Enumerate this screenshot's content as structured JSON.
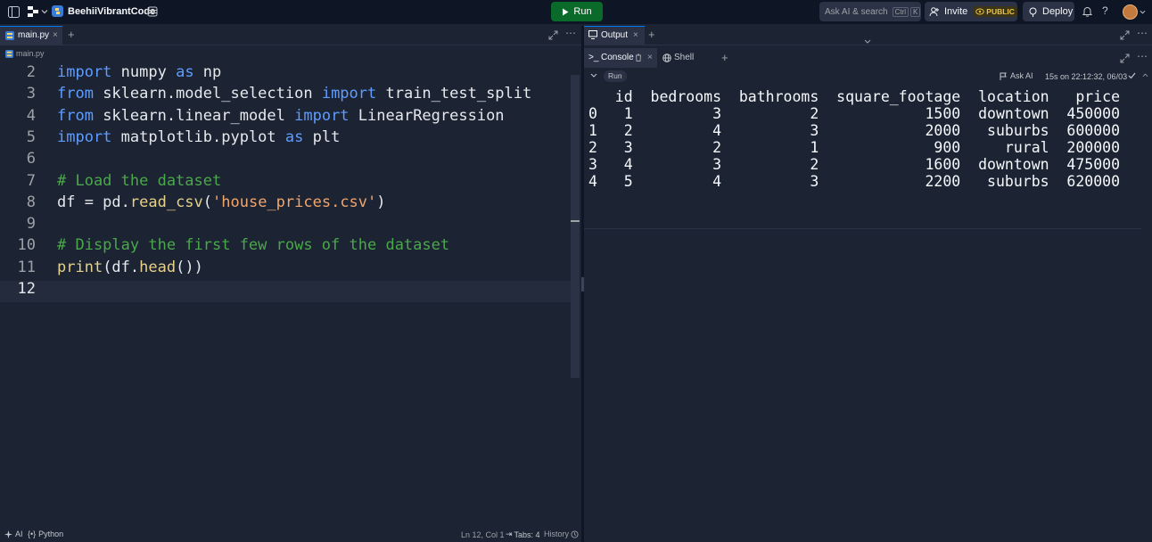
{
  "topbar": {
    "repl_name": "BeehiiVibrantCode",
    "run_label": "Run",
    "search_label": "Ask AI & search",
    "kbd_ctrl": "Ctrl",
    "kbd_k": "K",
    "invite_label": "Invite",
    "public_label": "PUBLIC",
    "deploy_label": "Deploy"
  },
  "editor": {
    "tab_label": "main.py",
    "breadcrumb": "main.py",
    "lines": [
      {
        "n": "2",
        "tokens": [
          [
            "kw",
            "import"
          ],
          [
            "pl",
            " numpy "
          ],
          [
            "kw",
            "as"
          ],
          [
            "pl",
            " np"
          ]
        ]
      },
      {
        "n": "3",
        "tokens": [
          [
            "kw",
            "from"
          ],
          [
            "pl",
            " sklearn.model_selection "
          ],
          [
            "kw",
            "import"
          ],
          [
            "pl",
            " train_test_split"
          ]
        ]
      },
      {
        "n": "4",
        "tokens": [
          [
            "kw",
            "from"
          ],
          [
            "pl",
            " sklearn.linear_model "
          ],
          [
            "kw",
            "import"
          ],
          [
            "pl",
            " LinearRegression"
          ]
        ]
      },
      {
        "n": "5",
        "tokens": [
          [
            "kw",
            "import"
          ],
          [
            "pl",
            " matplotlib.pyplot "
          ],
          [
            "kw",
            "as"
          ],
          [
            "pl",
            " plt"
          ]
        ]
      },
      {
        "n": "6",
        "tokens": []
      },
      {
        "n": "7",
        "tokens": [
          [
            "cm",
            "# Load the dataset"
          ]
        ]
      },
      {
        "n": "8",
        "tokens": [
          [
            "pl",
            "df = pd."
          ],
          [
            "fn",
            "read_csv"
          ],
          [
            "pl",
            "("
          ],
          [
            "str",
            "'house_prices.csv'"
          ],
          [
            "pl",
            ")"
          ]
        ]
      },
      {
        "n": "9",
        "tokens": []
      },
      {
        "n": "10",
        "tokens": [
          [
            "cm",
            "# Display the first few rows of the dataset"
          ]
        ]
      },
      {
        "n": "11",
        "tokens": [
          [
            "fn",
            "print"
          ],
          [
            "pl",
            "(df."
          ],
          [
            "fn",
            "head"
          ],
          [
            "pl",
            "())"
          ]
        ]
      },
      {
        "n": "12",
        "tokens": []
      }
    ]
  },
  "statusbar": {
    "ai_label": "AI",
    "language_label": "Python",
    "cursor": "Ln 12, Col 1",
    "tabs": "Tabs: 4",
    "history": "History"
  },
  "output": {
    "tab_label": "Output",
    "console_tab": "Console",
    "shell_tab": "Shell",
    "run_chip": "Run",
    "ask_ai": "Ask AI",
    "run_info": "15s on 22:12:32, 06/03",
    "header": "   id  bedrooms  bathrooms  square_footage  location   price",
    "rows": [
      "0   1         3          2            1500  downtown  450000",
      "1   2         4          3            2000   suburbs  600000",
      "2   3         2          1             900     rural  200000",
      "3   4         3          2            1600  downtown  475000",
      "4   5         4          3            2200   suburbs  620000"
    ]
  }
}
